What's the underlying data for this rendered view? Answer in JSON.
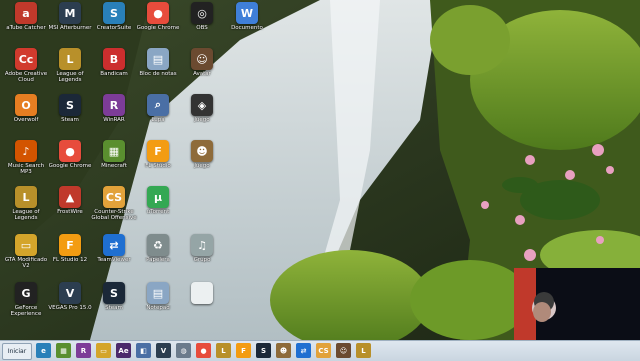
{
  "desktop": {
    "icons": [
      {
        "label": "aTube Catcher",
        "icon": "atube-icon",
        "color": "#c0392b",
        "glyph": "a"
      },
      {
        "label": "MSI Afterburner",
        "icon": "msi-icon",
        "color": "#2c3e50",
        "glyph": "M"
      },
      {
        "label": "CreatorSuite",
        "icon": "creatorsuite-icon",
        "color": "#2980b9",
        "glyph": "S"
      },
      {
        "label": "Google Chrome",
        "icon": "chrome-icon",
        "color": "#e74c3c",
        "glyph": "●"
      },
      {
        "label": "OBS",
        "icon": "obs-icon",
        "color": "#222222",
        "glyph": "◎"
      },
      {
        "label": "Documento",
        "icon": "document-icon",
        "color": "#3f7fd9",
        "glyph": "W"
      },
      {
        "label": "Adobe Creative Cloud",
        "icon": "creative-cloud-icon",
        "color": "#d13a2d",
        "glyph": "Cc"
      },
      {
        "label": "League of Legends",
        "icon": "lol-icon",
        "color": "#b8902a",
        "glyph": "L"
      },
      {
        "label": "Bandicam",
        "icon": "bandicam-icon",
        "color": "#cc2e2e",
        "glyph": "B"
      },
      {
        "label": "Bloc de notas",
        "icon": "notepad-icon",
        "color": "#8aa6c4",
        "glyph": "▤"
      },
      {
        "label": "Avatar",
        "icon": "photo-icon",
        "color": "#6b4a30",
        "glyph": "☺"
      },
      {
        "label": "Overwolf",
        "icon": "overwolf-icon",
        "color": "#e67e22",
        "glyph": "O"
      },
      {
        "label": "Steam",
        "icon": "steam-icon",
        "color": "#1b2838",
        "glyph": "S"
      },
      {
        "label": "WinRAR",
        "icon": "winrar-icon",
        "color": "#7d3c98",
        "glyph": "R"
      },
      {
        "label": "Lupa",
        "icon": "magnifier-icon",
        "color": "#4a6fa5",
        "glyph": "⌕"
      },
      {
        "label": "Juego",
        "icon": "game-icon",
        "color": "#333333",
        "glyph": "◈"
      },
      {
        "label": "Music Search MP3",
        "icon": "music-search-icon",
        "color": "#d35400",
        "glyph": "♪"
      },
      {
        "label": "Google Chrome",
        "icon": "chrome2-icon",
        "color": "#e74c3c",
        "glyph": "●"
      },
      {
        "label": "Minecraft",
        "icon": "minecraft-icon",
        "color": "#5a8f2f",
        "glyph": "▦"
      },
      {
        "label": "FL Studio",
        "icon": "flstudio-icon",
        "color": "#f39c12",
        "glyph": "F"
      },
      {
        "label": "Juego",
        "icon": "game2-icon",
        "color": "#8e6b3a",
        "glyph": "☻"
      },
      {
        "label": "League of Legends",
        "icon": "lol2-icon",
        "color": "#b8902a",
        "glyph": "L"
      },
      {
        "label": "FrostWire",
        "icon": "frostwire-icon",
        "color": "#c0392b",
        "glyph": "▲"
      },
      {
        "label": "Counter-Strike Global Offensive",
        "icon": "csgo-icon",
        "color": "#e2a23a",
        "glyph": "CS"
      },
      {
        "label": "uTorrent",
        "icon": "utorrent-icon",
        "color": "#34a853",
        "glyph": "µ"
      },
      {
        "label": "GTA Modificado V2",
        "icon": "folder-icon",
        "color": "#d4a52b",
        "glyph": "▭"
      },
      {
        "label": "FL Studio 12",
        "icon": "flstudio2-icon",
        "color": "#f39c12",
        "glyph": "F"
      },
      {
        "label": "TeamViewer",
        "icon": "teamviewer-icon",
        "color": "#1f6fd1",
        "glyph": "⇄"
      },
      {
        "label": "Papelera",
        "icon": "recycle-bin-icon",
        "color": "#7f8c8d",
        "glyph": "♻"
      },
      {
        "label": "Grupo",
        "icon": "audio-file-icon",
        "color": "#95a5a6",
        "glyph": "♫"
      },
      {
        "label": "GeForce Experience",
        "icon": "geforce-icon",
        "color": "#222222",
        "glyph": "G"
      },
      {
        "label": "VEGAS Pro 15.0",
        "icon": "vegas-icon",
        "color": "#2c3e50",
        "glyph": "V"
      },
      {
        "label": "Steam",
        "icon": "steam2-icon",
        "color": "#1b2838",
        "glyph": "S"
      },
      {
        "label": "Notepad",
        "icon": "notepad2-icon",
        "color": "#8aa6c4",
        "glyph": "▤"
      },
      {
        "label": "",
        "icon": "blank-file-icon",
        "color": "#ecf0f1",
        "glyph": ""
      }
    ]
  },
  "taskbar": {
    "start_label": "Iniciar",
    "items": [
      {
        "icon": "ie-icon",
        "color": "#2980b9",
        "glyph": "e"
      },
      {
        "icon": "minecraft-tb-icon",
        "color": "#5a8f2f",
        "glyph": "▦"
      },
      {
        "icon": "winrar-tb-icon",
        "color": "#7d3c98",
        "glyph": "R"
      },
      {
        "icon": "folder-tb-icon",
        "color": "#d4a52b",
        "glyph": "▭"
      },
      {
        "icon": "after-effects-icon",
        "color": "#4b2a6b",
        "glyph": "Ae"
      },
      {
        "icon": "explorer-icon",
        "color": "#4a6fa5",
        "glyph": "◧"
      },
      {
        "icon": "vegas-tb-icon",
        "color": "#2c3e50",
        "glyph": "V"
      },
      {
        "icon": "app-tb-icon",
        "color": "#6b7b8c",
        "glyph": "◍"
      },
      {
        "icon": "chrome-tb-icon",
        "color": "#e74c3c",
        "glyph": "●"
      },
      {
        "icon": "lol-tb-icon",
        "color": "#b8902a",
        "glyph": "L"
      },
      {
        "icon": "flstudio-tb-icon",
        "color": "#f39c12",
        "glyph": "F"
      },
      {
        "icon": "steam-tb-icon",
        "color": "#1b2838",
        "glyph": "S"
      },
      {
        "icon": "game-tb-icon",
        "color": "#8e6b3a",
        "glyph": "☻"
      },
      {
        "icon": "teamviewer-tb-icon",
        "color": "#1f6fd1",
        "glyph": "⇄"
      },
      {
        "icon": "csgo-tb-icon",
        "color": "#e2a23a",
        "glyph": "CS"
      },
      {
        "icon": "photo-tb-icon",
        "color": "#6b4a30",
        "glyph": "☺"
      },
      {
        "icon": "lol2-tb-icon",
        "color": "#b8902a",
        "glyph": "L"
      }
    ]
  }
}
